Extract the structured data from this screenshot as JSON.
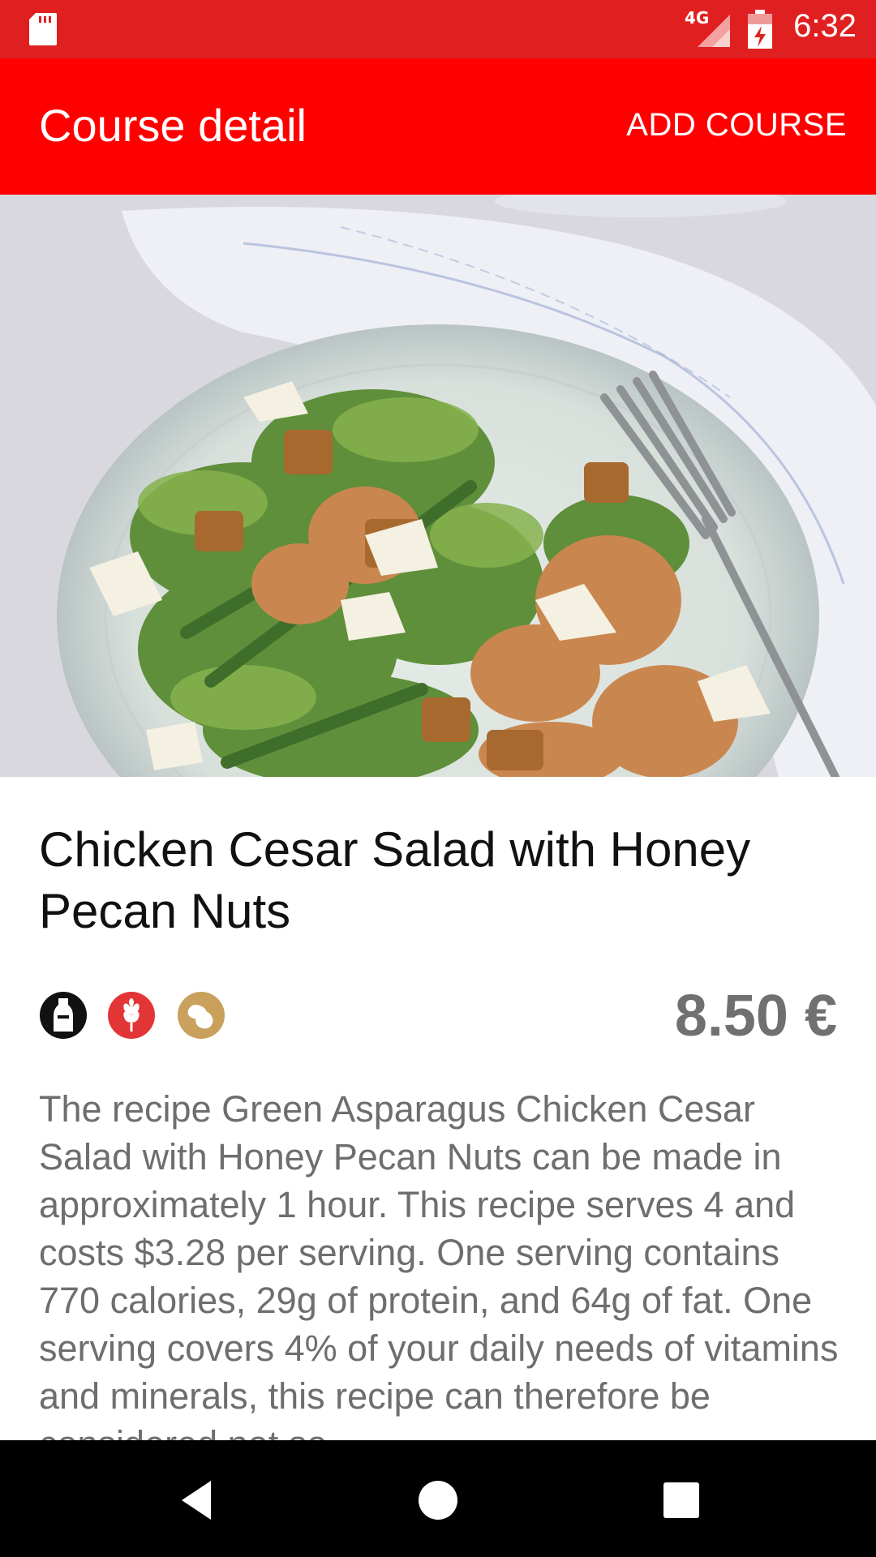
{
  "status_bar": {
    "network": "4G",
    "time": "6:32",
    "icons": [
      "sd-card-icon",
      "signal-icon",
      "battery-charging-icon"
    ]
  },
  "app_bar": {
    "title": "Course detail",
    "action_label": "ADD COURSE"
  },
  "course": {
    "title": "Chicken Cesar Salad with Honey Pecan Nuts",
    "price": "8.50 €",
    "allergens": [
      {
        "icon": "milk-bottle-icon",
        "color": "#111111"
      },
      {
        "icon": "gluten-wheat-icon",
        "color": "#e23535"
      },
      {
        "icon": "peanut-icon",
        "color": "#c9a05c"
      }
    ],
    "description": "The recipe Green Asparagus Chicken Cesar Salad with Honey Pecan Nuts can be made in approximately 1 hour. This recipe serves 4 and costs $3.28 per serving. One serving contains 770 calories, 29g of protein, and 64g of fat. One serving covers 4% of your daily needs of vitamins and minerals, this recipe can therefore be considered not so"
  },
  "nav_bar": {
    "icons": [
      "back-icon",
      "home-icon",
      "recents-icon"
    ]
  },
  "colors": {
    "status_bar": "#e02020",
    "app_bar": "#ff0000",
    "price": "#707070",
    "description": "#6e6e6e"
  }
}
